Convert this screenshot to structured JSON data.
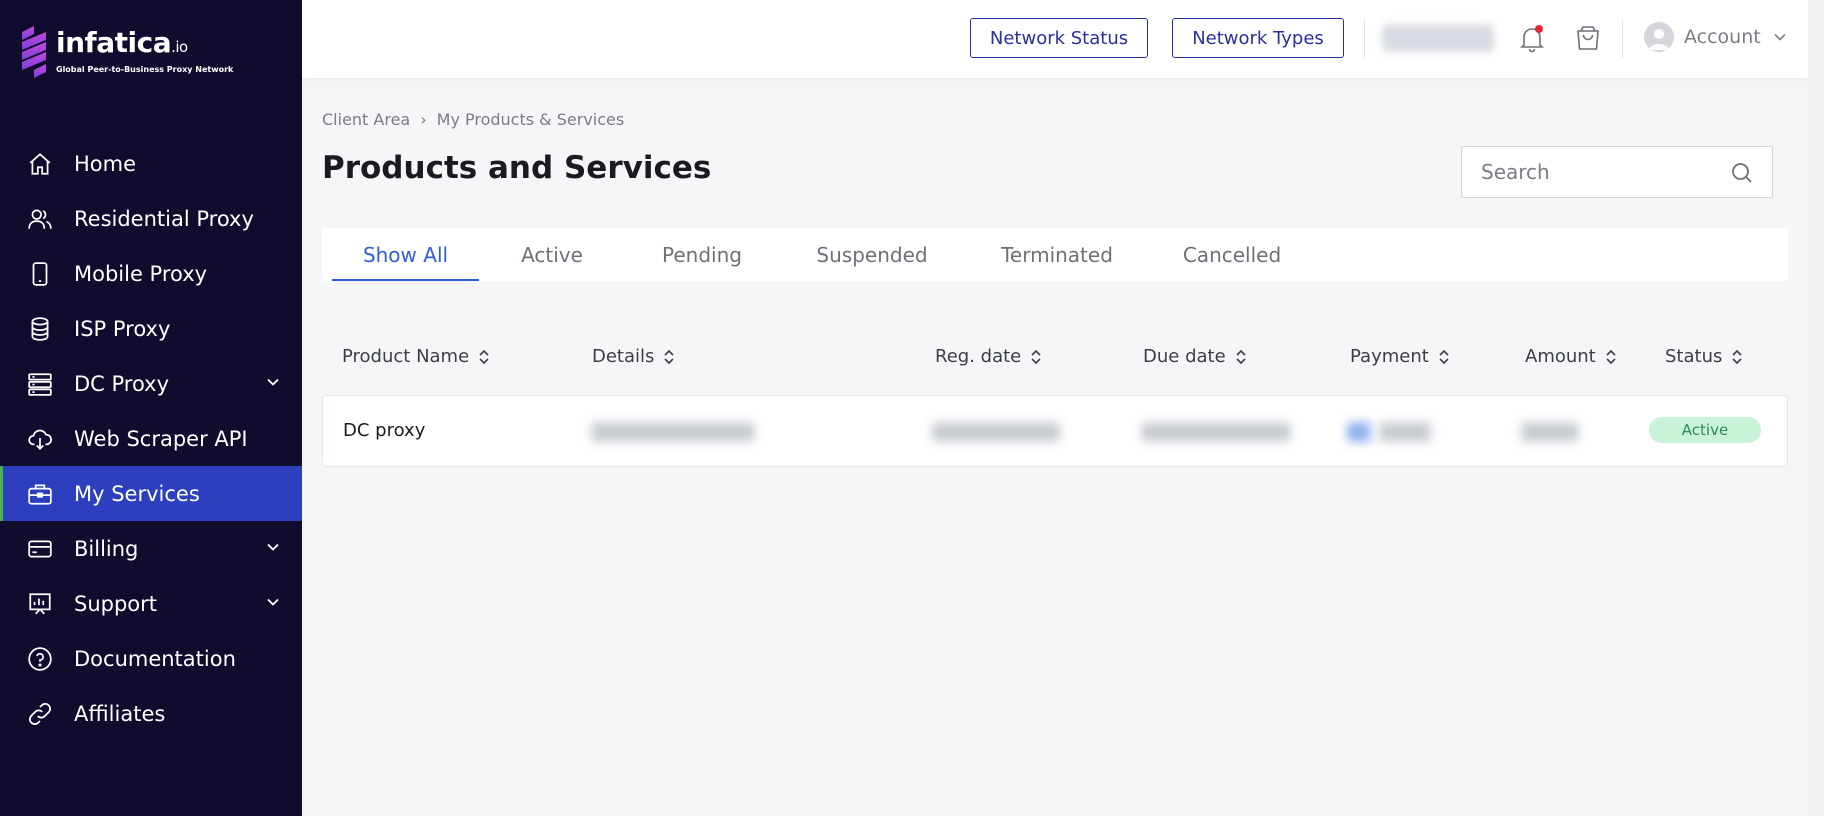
{
  "brand": {
    "name": "infatica",
    "suffix": ".io",
    "tagline": "Global Peer-to-Business Proxy Network",
    "sidebar_bg": "#0f0c2e",
    "active_bg": "#2b3fbf",
    "accent": "#2f5fd7"
  },
  "sidebar": {
    "items": [
      {
        "label": "Home",
        "icon": "home-icon"
      },
      {
        "label": "Residential Proxy",
        "icon": "users-icon"
      },
      {
        "label": "Mobile Proxy",
        "icon": "phone-icon"
      },
      {
        "label": "ISP Proxy",
        "icon": "database-icon"
      },
      {
        "label": "DC Proxy",
        "icon": "server-icon",
        "expandable": true
      },
      {
        "label": "Web Scraper API",
        "icon": "cloud-download-icon"
      },
      {
        "label": "My Services",
        "icon": "briefcase-icon",
        "active": true
      },
      {
        "label": "Billing",
        "icon": "credit-card-icon",
        "expandable": true
      },
      {
        "label": "Support",
        "icon": "chart-icon",
        "expandable": true
      },
      {
        "label": "Documentation",
        "icon": "help-circle-icon"
      },
      {
        "label": "Affiliates",
        "icon": "link-icon"
      }
    ]
  },
  "topbar": {
    "network_status": "Network Status",
    "network_types": "Network Types",
    "account": "Account",
    "notification_dot_color": "#e3262f"
  },
  "breadcrumb": {
    "root": "Client Area",
    "separator": "›",
    "current": "My Products & Services"
  },
  "page": {
    "title": "Products and Services"
  },
  "search": {
    "placeholder": "Search"
  },
  "tabs": [
    "Show All",
    "Active",
    "Pending",
    "Suspended",
    "Terminated",
    "Cancelled"
  ],
  "table": {
    "columns": [
      "Product Name",
      "Details",
      "Reg. date",
      "Due date",
      "Payment",
      "Amount",
      "Status"
    ],
    "rows": [
      {
        "product_name": "DC proxy",
        "status": "Active",
        "status_color": "#2f8c55",
        "status_bg": "#c9f3d8"
      }
    ]
  }
}
